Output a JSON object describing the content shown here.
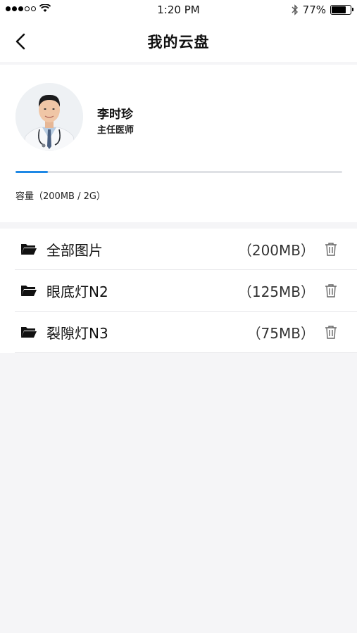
{
  "status_bar": {
    "time": "1:20 PM",
    "battery": "77%",
    "battery_level": 0.77
  },
  "header": {
    "title": "我的云盘",
    "back_icon": "chevron-left-icon"
  },
  "profile": {
    "name": "李时珍",
    "title": "主任医师",
    "capacity_label": "容量（200MB / 2G）",
    "used_fraction": 0.1,
    "accent_color": "#1e88e5"
  },
  "folders": [
    {
      "name": "全部图片",
      "size": "（200MB）"
    },
    {
      "name": "眼底灯N2",
      "size": "（125MB）"
    },
    {
      "name": "裂隙灯N3",
      "size": "（75MB）"
    }
  ]
}
